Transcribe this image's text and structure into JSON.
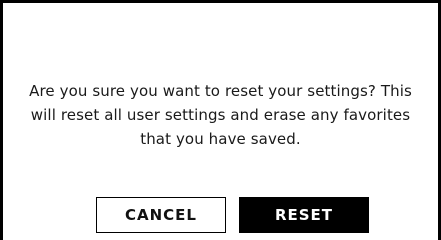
{
  "dialog": {
    "message": "Are you sure you want to reset your settings? This will reset all user settings and erase any favorites that you have saved.",
    "cancel_label": "CANCEL",
    "reset_label": "RESET"
  },
  "colors": {
    "border": "#000000",
    "background": "#ffffff",
    "primary_button_bg": "#000000",
    "primary_button_text": "#ffffff",
    "secondary_button_bg": "#ffffff",
    "secondary_button_text": "#111111"
  }
}
